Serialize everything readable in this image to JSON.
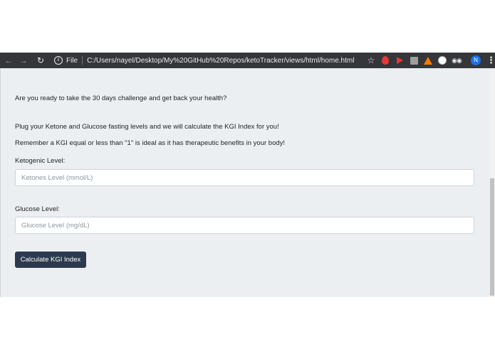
{
  "browser": {
    "file_label": "File",
    "url": "C:/Users/nayel/Desktop/My%20GitHub%20Repos/ketoTracker/views/html/home.html",
    "profile_initial": "N"
  },
  "page": {
    "intro": "Are you ready to take the 30 days challenge and get back your health?",
    "instructions": "Plug your Ketone and Glucose fasting levels and we will calculate the KGI Index for you!",
    "reminder": "Remember a KGI equal or less than \"1\" is ideal as it has therapeutic benefits in your body!",
    "ketone_label": "Ketogenic Level:",
    "ketone_placeholder": "Ketones Level (mmol/L)",
    "glucose_label": "Glucose Level:",
    "glucose_placeholder": "Glucose Level (mg/dL)",
    "calculate_button": "Calculate KGI Index"
  }
}
